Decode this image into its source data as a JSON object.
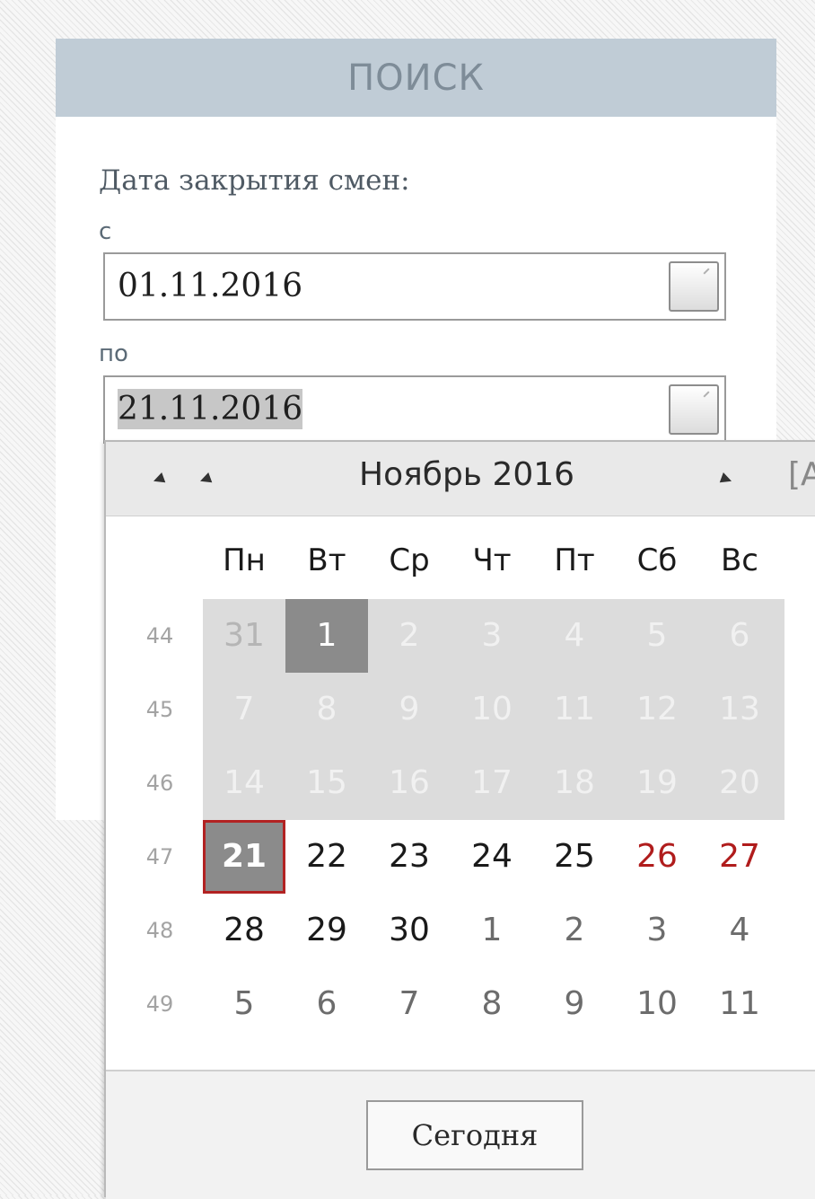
{
  "panel": {
    "title": "ПОИСК",
    "date_label": "Дата закрытия смен:",
    "from_label": "с",
    "from_value": "01.11.2016",
    "to_label": "по",
    "to_value": "21.11.2016"
  },
  "calendar": {
    "month_title": "Ноябрь 2016",
    "view_button": "[A",
    "weekdays": [
      "Пн",
      "Вт",
      "Ср",
      "Чт",
      "Пт",
      "Сб",
      "Вс"
    ],
    "weeks": [
      {
        "num": "44",
        "days": [
          "31",
          "1",
          "2",
          "3",
          "4",
          "5",
          "6"
        ]
      },
      {
        "num": "45",
        "days": [
          "7",
          "8",
          "9",
          "10",
          "11",
          "12",
          "13"
        ]
      },
      {
        "num": "46",
        "days": [
          "14",
          "15",
          "16",
          "17",
          "18",
          "19",
          "20"
        ]
      },
      {
        "num": "47",
        "days": [
          "21",
          "22",
          "23",
          "24",
          "25",
          "26",
          "27"
        ]
      },
      {
        "num": "48",
        "days": [
          "28",
          "29",
          "30",
          "1",
          "2",
          "3",
          "4"
        ]
      },
      {
        "num": "49",
        "days": [
          "5",
          "6",
          "7",
          "8",
          "9",
          "10",
          "11"
        ]
      }
    ],
    "today_button": "Сегодня"
  },
  "colors": {
    "header_bg": "#c0ccd6",
    "range_bg": "#dcdcdc",
    "selected_bg": "#8b8b8b",
    "selected_border": "#b22222",
    "weekend": "#b01c1c"
  }
}
